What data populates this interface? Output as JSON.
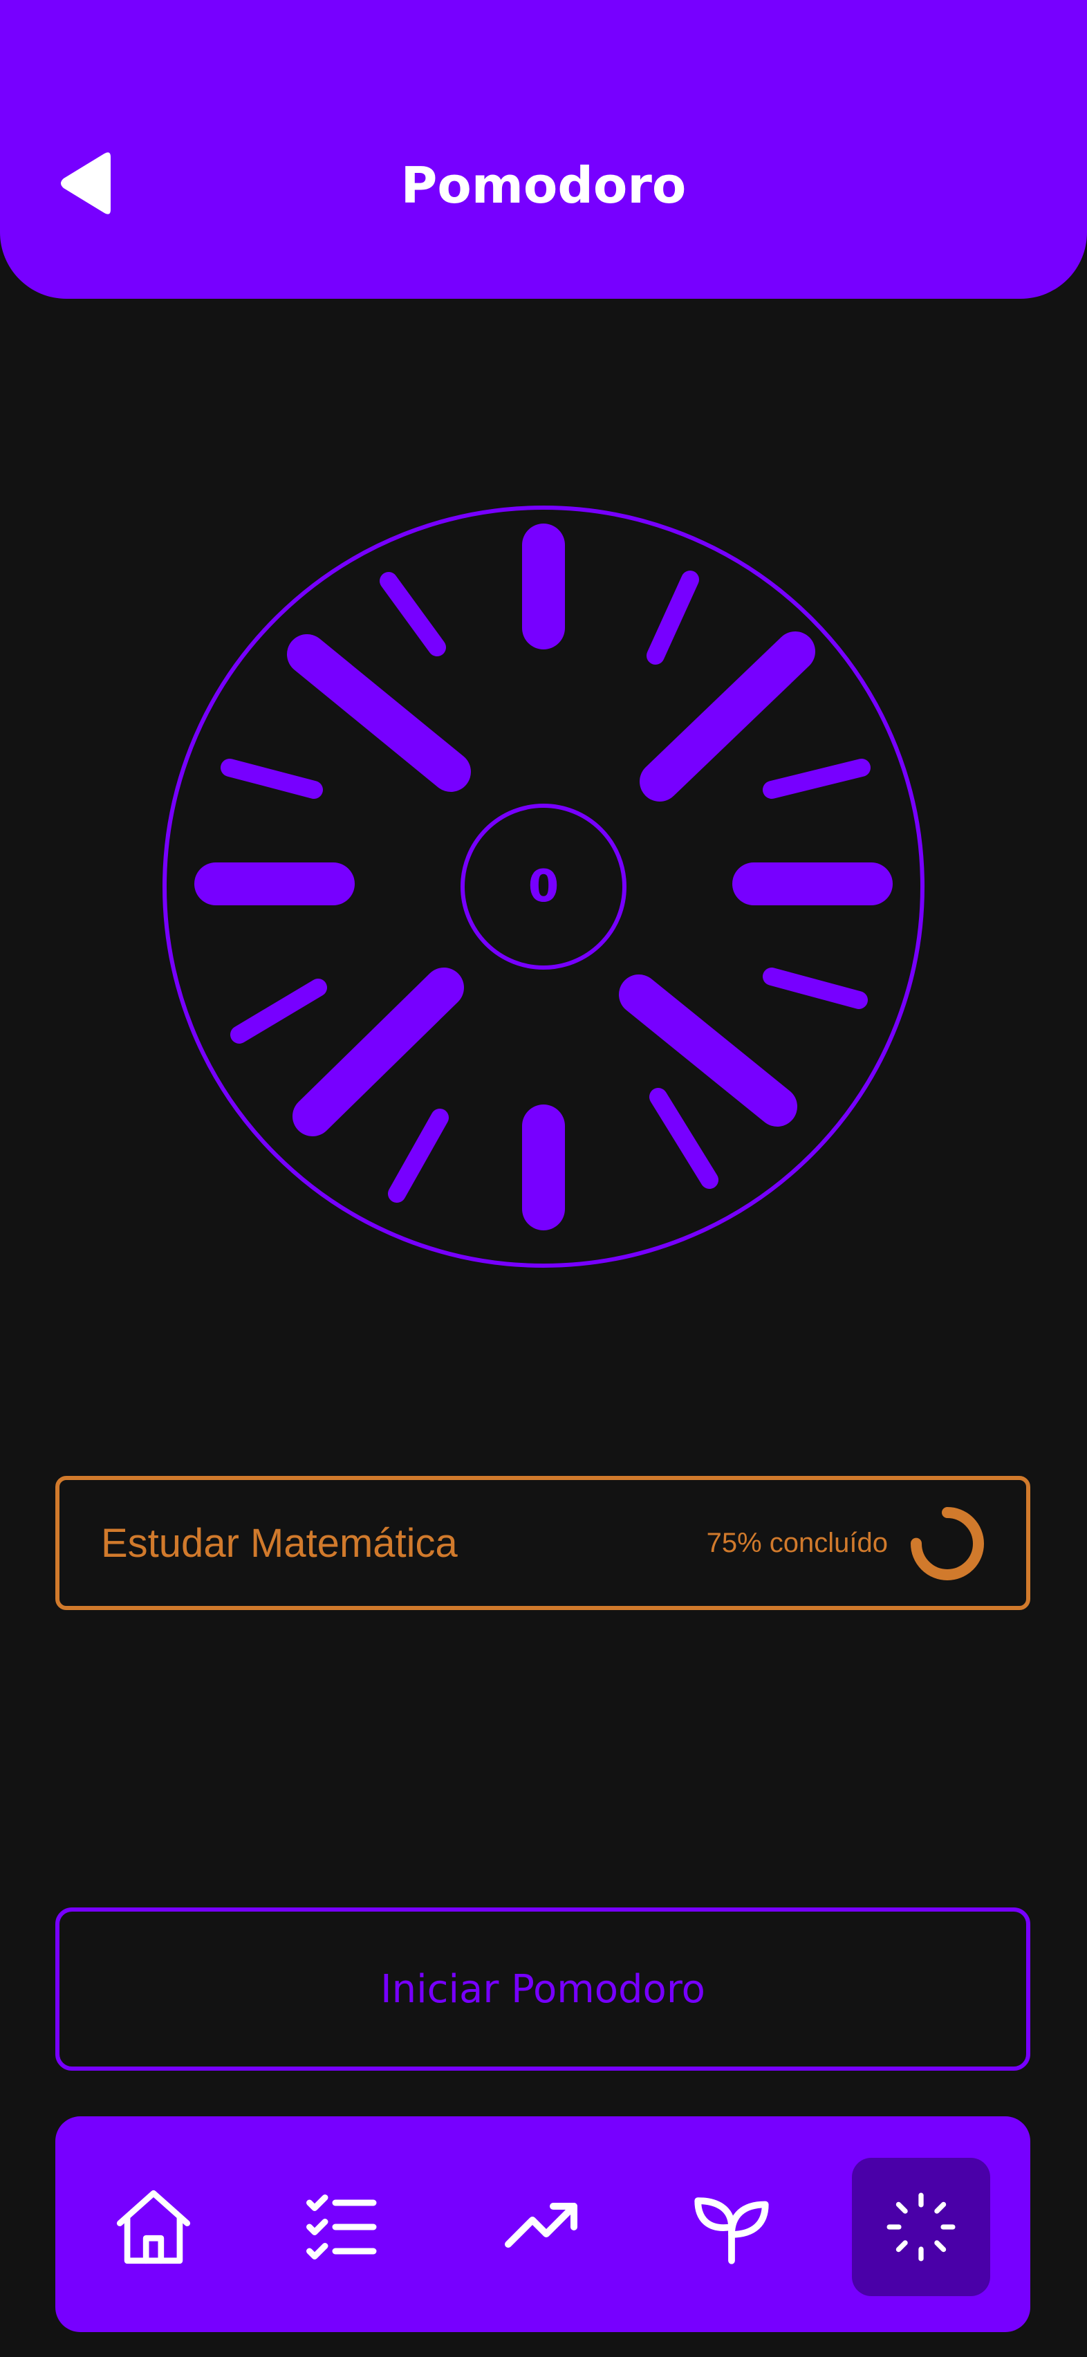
{
  "header": {
    "title": "Pomodoro",
    "back_icon": "back-triangle-icon"
  },
  "timer": {
    "count": "0",
    "accent_color": "#7700FF"
  },
  "task": {
    "title": "Estudar Matemática",
    "progress_label": "75% concluído",
    "progress": 0.75,
    "color": "#D17A2C"
  },
  "actions": {
    "start_label": "Iniciar Pomodoro"
  },
  "bottom_nav": {
    "items": [
      {
        "icon": "home-icon",
        "active": false
      },
      {
        "icon": "checklist-icon",
        "active": false
      },
      {
        "icon": "trending-up-icon",
        "active": false
      },
      {
        "icon": "leaf-icon",
        "active": false
      },
      {
        "icon": "loader-icon",
        "active": true
      }
    ]
  },
  "colors": {
    "background": "#121212",
    "primary": "#7700FF",
    "nav_active": "#4A00A8",
    "accent_orange": "#D17A2C",
    "text_light": "#FFFFFF"
  }
}
